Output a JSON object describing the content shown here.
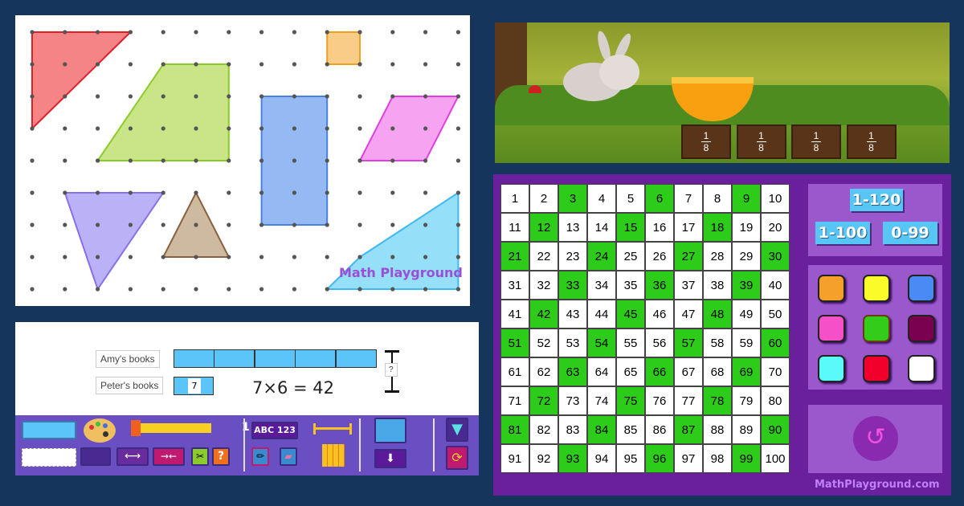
{
  "geoboard": {
    "brand": "Math Playground",
    "shapes": [
      {
        "name": "red-triangle",
        "fill": "#f4777a",
        "stroke": "#e0202a"
      },
      {
        "name": "orange-square",
        "fill": "#f8c77a",
        "stroke": "#f0a020"
      },
      {
        "name": "green-trapezoid",
        "fill": "#c3e27a",
        "stroke": "#8ccc2a"
      },
      {
        "name": "blue-rectangle",
        "fill": "#8ab2f2",
        "stroke": "#4a80e0"
      },
      {
        "name": "pink-parallelogram",
        "fill": "#f59af0",
        "stroke": "#e040e0"
      },
      {
        "name": "purple-triangle",
        "fill": "#b4a8f5",
        "stroke": "#8a70e8"
      },
      {
        "name": "brown-triangle",
        "fill": "#c8b296",
        "stroke": "#8a6040"
      },
      {
        "name": "cyan-quadrilateral",
        "fill": "#8adcf8",
        "stroke": "#40b8f0"
      }
    ]
  },
  "bar_model": {
    "label1": "Amy's books",
    "label2": "Peter's books",
    "unit_value": "7",
    "total_label": "?",
    "equation": "7×6 = 42",
    "slider_value": "1",
    "text_button": "ABC 123"
  },
  "game": {
    "fractions": [
      {
        "num": "1",
        "den": "8"
      },
      {
        "num": "1",
        "den": "8"
      },
      {
        "num": "1",
        "den": "8"
      },
      {
        "num": "1",
        "den": "8"
      }
    ]
  },
  "hundred_chart": {
    "numbers": [
      1,
      2,
      3,
      4,
      5,
      6,
      7,
      8,
      9,
      10,
      11,
      12,
      13,
      14,
      15,
      16,
      17,
      18,
      19,
      20,
      21,
      22,
      23,
      24,
      25,
      26,
      27,
      28,
      29,
      30,
      31,
      32,
      33,
      34,
      35,
      36,
      37,
      38,
      39,
      40,
      41,
      42,
      43,
      44,
      45,
      46,
      47,
      48,
      49,
      50,
      51,
      52,
      53,
      54,
      55,
      56,
      57,
      58,
      59,
      60,
      61,
      62,
      63,
      64,
      65,
      66,
      67,
      68,
      69,
      70,
      71,
      72,
      73,
      74,
      75,
      76,
      77,
      78,
      79,
      80,
      81,
      82,
      83,
      84,
      85,
      86,
      87,
      88,
      89,
      90,
      91,
      92,
      93,
      94,
      95,
      96,
      97,
      98,
      99,
      100
    ],
    "highlighted": [
      3,
      6,
      9,
      12,
      15,
      18,
      21,
      24,
      27,
      30,
      33,
      36,
      39,
      42,
      45,
      48,
      51,
      54,
      57,
      60,
      63,
      66,
      69,
      72,
      75,
      78,
      81,
      84,
      87,
      90,
      93,
      96,
      99
    ],
    "highlight_color": "#2ecc1a",
    "range_buttons": [
      "1-120",
      "1-100",
      "0-99"
    ],
    "swatches": [
      "#f5a02a",
      "#fbfb2a",
      "#4a8af5",
      "#f550c8",
      "#33cc1a",
      "#7a0050",
      "#5afafa",
      "#f0002a",
      "#ffffff"
    ],
    "selected_swatch": 4,
    "brand": "MathPlayground.com"
  }
}
